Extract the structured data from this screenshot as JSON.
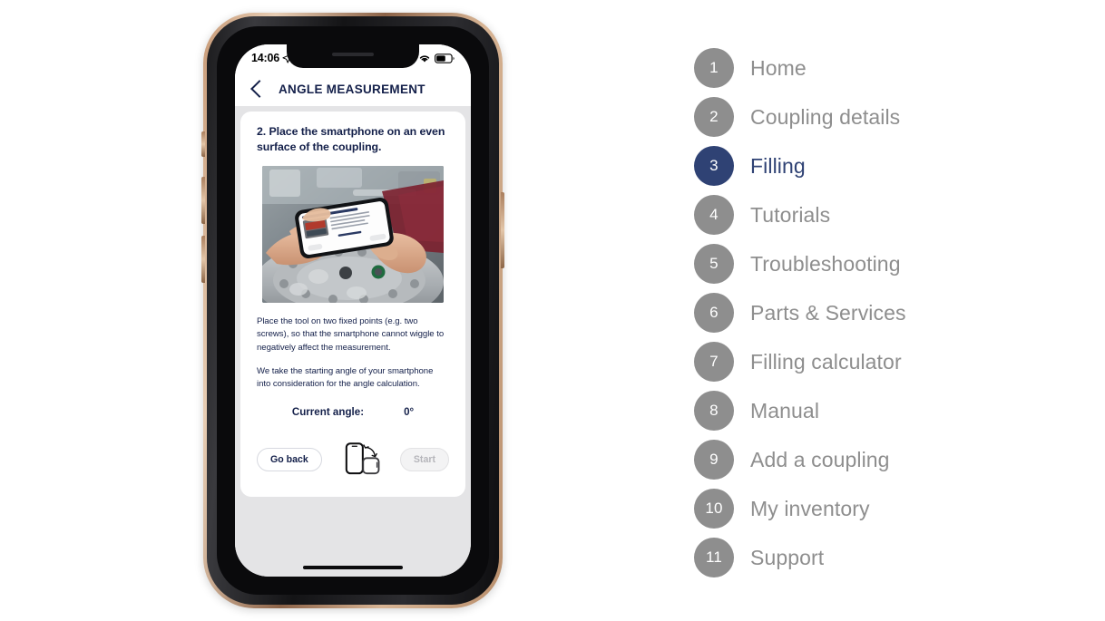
{
  "phone": {
    "status_bar": {
      "time": "14:06",
      "location_icon": "location-arrow-icon",
      "cellular_icon": "cellular-signal-icon",
      "wifi_icon": "wifi-icon",
      "battery_icon": "battery-icon"
    },
    "nav": {
      "back_icon": "chevron-left-icon",
      "title": "ANGLE MEASUREMENT"
    },
    "card": {
      "title": "2. Place the smartphone on an even surface of the coupling.",
      "photo_alt": "hands-holding-smartphone-on-coupling-photo",
      "paragraph_1": "Place the tool on two fixed points (e.g. two screws), so that the smartphone cannot wiggle to negatively affect the measurement.",
      "paragraph_2": "We take the starting angle of your smartphone into consideration for the angle calculation.",
      "angle_label": "Current angle:",
      "angle_value": "0°",
      "go_back_label": "Go back",
      "rotate_icon": "phone-rotate-icon",
      "start_label": "Start"
    }
  },
  "steps": {
    "active_index": 2,
    "items": [
      {
        "number": "1",
        "label": "Home"
      },
      {
        "number": "2",
        "label": "Coupling details"
      },
      {
        "number": "3",
        "label": "Filling"
      },
      {
        "number": "4",
        "label": "Tutorials"
      },
      {
        "number": "5",
        "label": "Troubleshooting"
      },
      {
        "number": "6",
        "label": "Parts & Services"
      },
      {
        "number": "7",
        "label": "Filling calculator"
      },
      {
        "number": "8",
        "label": "Manual"
      },
      {
        "number": "9",
        "label": "Add a coupling"
      },
      {
        "number": "10",
        "label": "My inventory"
      },
      {
        "number": "11",
        "label": "Support"
      }
    ]
  },
  "colors": {
    "navy": "#14204a",
    "accent": "#2f4274",
    "muted_gray": "#8e8e8e",
    "screen_bg": "#e4e4e6"
  }
}
